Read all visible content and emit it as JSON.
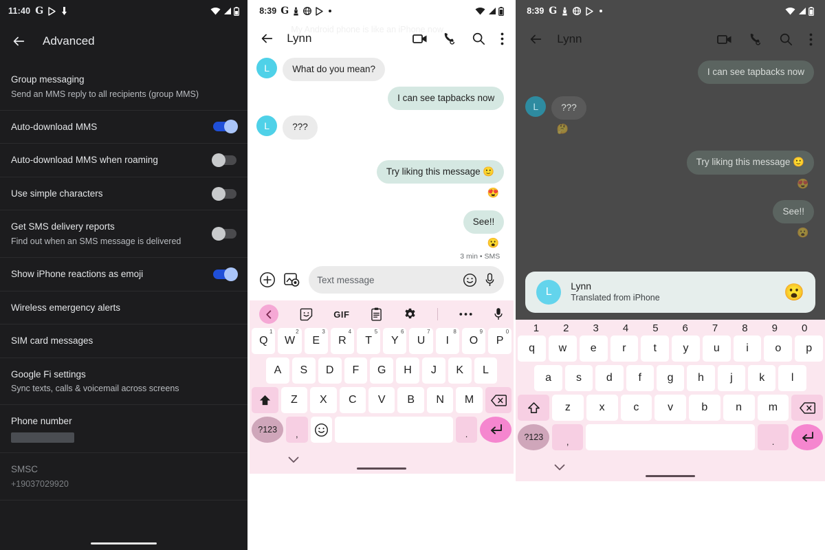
{
  "settings_panel": {
    "status_bar": {
      "time": "11:40",
      "icons": [
        "google-g-icon",
        "play-store-icon",
        "download-icon"
      ],
      "right_icons": [
        "wifi-icon",
        "signal-icon",
        "battery-icon"
      ]
    },
    "appbar": {
      "back_label": "back-arrow-icon",
      "title": "Advanced"
    },
    "rows": [
      {
        "title": "Group messaging",
        "subtitle": "Send an MMS reply to all recipients (group MMS)",
        "control": "none"
      },
      {
        "title": "Auto-download MMS",
        "subtitle": "",
        "control": "toggle",
        "toggle_on": true
      },
      {
        "title": "Auto-download MMS when roaming",
        "subtitle": "",
        "control": "toggle",
        "toggle_on": false
      },
      {
        "title": "Use simple characters",
        "subtitle": "",
        "control": "toggle",
        "toggle_on": false
      },
      {
        "title": "Get SMS delivery reports",
        "subtitle": "Find out when an SMS message is delivered",
        "control": "toggle",
        "toggle_on": false
      },
      {
        "title": "Show iPhone reactions as emoji",
        "subtitle": "",
        "control": "toggle",
        "toggle_on": true
      },
      {
        "title": "Wireless emergency alerts",
        "subtitle": "",
        "control": "none"
      },
      {
        "title": "SIM card messages",
        "subtitle": "",
        "control": "none"
      },
      {
        "title": "Google Fi settings",
        "subtitle": "Sync texts, calls & voicemail across screens",
        "control": "none"
      },
      {
        "title": "Phone number",
        "subtitle": "",
        "control": "redacted"
      },
      {
        "title": "SMSC",
        "subtitle": "+19037029920",
        "control": "none",
        "dim": true
      }
    ],
    "colors": {
      "background": "#1c1c1e",
      "toggle_on": "#1f4fd8",
      "toggle_off": "#4a4a4d"
    }
  },
  "convo_panel": {
    "status_bar": {
      "time": "8:39",
      "icons": [
        "google-g-icon",
        "chess-piece-icon",
        "globe-icon",
        "play-store-icon",
        "dot-icon"
      ],
      "right_icons": [
        "wifi-icon",
        "signal-icon",
        "battery-icon"
      ]
    },
    "watermark": "My Android phone is like an iPhone now",
    "appbar": {
      "title": "Lynn",
      "actions": [
        "video-call-icon",
        "phone-call-icon",
        "search-icon",
        "overflow-menu-icon"
      ]
    },
    "messages": [
      {
        "side": "in",
        "avatar": "L",
        "text": "What do you mean?",
        "reaction": ""
      },
      {
        "side": "out",
        "text": "I can see tapbacks now",
        "reaction": ""
      },
      {
        "side": "in",
        "avatar": "L",
        "text": "???",
        "reaction": ""
      },
      {
        "side": "out",
        "text": "Try liking this message 🙂",
        "reaction": "😍"
      },
      {
        "side": "out",
        "text": "See!!",
        "reaction": "😮"
      }
    ],
    "timestamp": "3 min • SMS",
    "composer": {
      "attach_icon": "plus-circle-icon",
      "gallery_icon": "gallery-camera-icon",
      "placeholder": "Text message",
      "emoji_icon": "emoji-smiley-icon",
      "mic_icon": "microphone-icon"
    },
    "colors": {
      "bubble_in": "#ebebeb",
      "bubble_out": "#d5e8e2",
      "avatar": "#4fd1e8"
    }
  },
  "keyboard": {
    "toolbar": [
      "back-chevron-icon",
      "sticker-icon",
      "GIF",
      "clipboard-icon",
      "gear-icon",
      "more-dots-icon",
      "microphone-icon"
    ],
    "upper_rows": [
      [
        {
          "k": "Q",
          "sup": "1"
        },
        {
          "k": "W",
          "sup": "2"
        },
        {
          "k": "E",
          "sup": "3"
        },
        {
          "k": "R",
          "sup": "4"
        },
        {
          "k": "T",
          "sup": "5"
        },
        {
          "k": "Y",
          "sup": "6"
        },
        {
          "k": "U",
          "sup": "7"
        },
        {
          "k": "I",
          "sup": "8"
        },
        {
          "k": "O",
          "sup": "9"
        },
        {
          "k": "P",
          "sup": "0"
        }
      ],
      [
        {
          "k": "A"
        },
        {
          "k": "S"
        },
        {
          "k": "D"
        },
        {
          "k": "F"
        },
        {
          "k": "G"
        },
        {
          "k": "H"
        },
        {
          "k": "J"
        },
        {
          "k": "K"
        },
        {
          "k": "L"
        }
      ],
      [
        {
          "k": "Z"
        },
        {
          "k": "X"
        },
        {
          "k": "C"
        },
        {
          "k": "V"
        },
        {
          "k": "B"
        },
        {
          "k": "N"
        },
        {
          "k": "M"
        }
      ]
    ],
    "shift_icon": "shift-filled-icon",
    "backspace_icon": "backspace-icon",
    "numeric_key": "?123",
    "comma_key": ",",
    "period_key": ".",
    "emoji_key": "emoji-smiley-icon",
    "enter_icon": "enter-return-icon",
    "collapse_icon": "chevron-down-icon",
    "colors": {
      "background": "#fbe7ef",
      "key": "#ffffff",
      "tinted": "#f7cfe3",
      "enter": "#f586cf"
    }
  },
  "keyboard_lower": {
    "number_row": [
      "1",
      "2",
      "3",
      "4",
      "5",
      "6",
      "7",
      "8",
      "9",
      "0"
    ],
    "rows": [
      [
        {
          "k": "q"
        },
        {
          "k": "w"
        },
        {
          "k": "e"
        },
        {
          "k": "r"
        },
        {
          "k": "t"
        },
        {
          "k": "y"
        },
        {
          "k": "u"
        },
        {
          "k": "i"
        },
        {
          "k": "o"
        },
        {
          "k": "p"
        }
      ],
      [
        {
          "k": "a"
        },
        {
          "k": "s"
        },
        {
          "k": "d"
        },
        {
          "k": "f"
        },
        {
          "k": "g"
        },
        {
          "k": "h"
        },
        {
          "k": "j"
        },
        {
          "k": "k"
        },
        {
          "k": "l"
        }
      ],
      [
        {
          "k": "z"
        },
        {
          "k": "x"
        },
        {
          "k": "c"
        },
        {
          "k": "v"
        },
        {
          "k": "b"
        },
        {
          "k": "n"
        },
        {
          "k": "m"
        }
      ]
    ],
    "shift_icon": "shift-outline-icon",
    "backspace_icon": "backspace-icon",
    "numeric_key": "?123",
    "comma_key": ",",
    "period_key": ".",
    "enter_icon": "enter-return-icon",
    "collapse_icon": "chevron-down-icon"
  },
  "dim_panel": {
    "status_bar": {
      "time": "8:39",
      "icons": [
        "google-g-icon",
        "chess-piece-icon",
        "globe-icon",
        "play-store-icon",
        "dot-icon"
      ],
      "right_icons": [
        "wifi-icon",
        "signal-icon",
        "battery-icon"
      ]
    },
    "appbar": {
      "title": "Lynn",
      "actions": [
        "video-call-icon",
        "phone-call-icon",
        "search-icon",
        "overflow-menu-icon"
      ]
    },
    "messages": [
      {
        "side": "out",
        "text": "I can see tapbacks now",
        "reaction": ""
      },
      {
        "side": "in",
        "avatar": "L",
        "text": "???",
        "reaction": "🤔"
      },
      {
        "side": "out",
        "text": "Try liking this message 🙂",
        "reaction": "😍"
      },
      {
        "side": "out",
        "text": "See!!",
        "reaction": "😮"
      }
    ],
    "notification": {
      "avatar_letter": "L",
      "title": "Lynn",
      "subtitle": "Translated from iPhone",
      "emoji": "😮"
    },
    "colors": {
      "scrim": "#4a4a4a",
      "card": "#e6eeec",
      "avatar": "#63d4ec"
    }
  }
}
